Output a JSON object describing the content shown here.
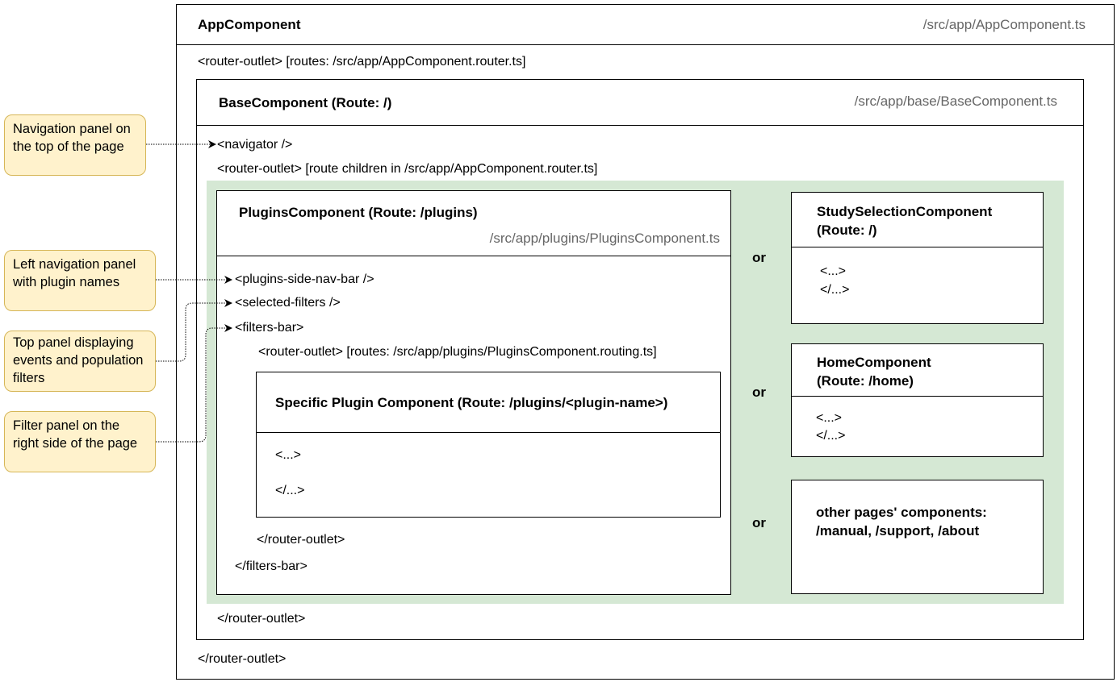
{
  "app": {
    "title": "AppComponent",
    "path": "/src/app/AppComponent.ts",
    "outlet_open": "<router-outlet> [routes: /src/app/AppComponent.router.ts]",
    "outlet_close": "</router-outlet>"
  },
  "base": {
    "title": "BaseComponent (Route: /)",
    "path": "/src/app/base/BaseComponent.ts",
    "navigator": "<navigator />",
    "outlet_open": "<router-outlet> [route children in /src/app/AppComponent.router.ts]",
    "outlet_close": "</router-outlet>"
  },
  "plugins": {
    "title": "PluginsComponent (Route: /plugins)",
    "path": "/src/app/plugins/PluginsComponent.ts",
    "side_nav": "<plugins-side-nav-bar />",
    "selected_filters": "<selected-filters />",
    "filters_bar_open": "<filters-bar>",
    "outlet_open": "<router-outlet> [routes: /src/app/plugins/PluginsComponent.routing.ts]",
    "outlet_close": "</router-outlet>",
    "filters_bar_close": "</filters-bar>"
  },
  "specific": {
    "title": "Specific Plugin Component (Route: /plugins/<plugin-name>)",
    "open": "<...>",
    "close": "</...>"
  },
  "or_label": "or",
  "study": {
    "title_line1": "StudySelectionComponent",
    "title_line2": "(Route: /)",
    "open": "<...>",
    "close": "</...>"
  },
  "home": {
    "title_line1": "HomeComponent",
    "title_line2": "(Route: /home)",
    "open": "<...>",
    "close": "</...>"
  },
  "other": {
    "line1": "other pages' components:",
    "line2": "/manual, /support, /about"
  },
  "callouts": [
    {
      "line1": "Navigation panel on",
      "line2": "the top of the page"
    },
    {
      "line1": "Left navigation panel",
      "line2": "with plugin names"
    },
    {
      "line1": "Top panel displaying",
      "line2": "events and population",
      "line3": "filters"
    },
    {
      "line1": "Filter panel on the",
      "line2": "right side of the page"
    }
  ],
  "colors": {
    "container_green": "#d5e8d4",
    "callout_fill": "#fff2cc",
    "callout_border": "#d6b656"
  }
}
